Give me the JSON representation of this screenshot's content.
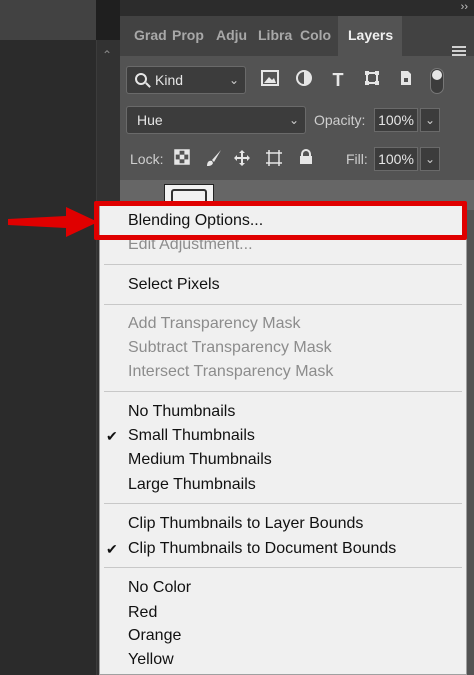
{
  "tabs": [
    "Grad",
    "Prop",
    "Adju",
    "Libra",
    "Colo",
    "Layers"
  ],
  "active_tab": "Layers",
  "filter": {
    "kind_label": "Kind"
  },
  "blend": {
    "mode": "Hue",
    "opacity_label": "Opacity:",
    "opacity_value": "100%"
  },
  "lock": {
    "label": "Lock:",
    "fill_label": "Fill:",
    "fill_value": "100%"
  },
  "menu": {
    "items": [
      {
        "label": "Blending Options...",
        "enabled": true,
        "checked": false
      },
      {
        "label": "Edit Adjustment...",
        "enabled": false,
        "checked": false
      },
      {
        "label": "Select Pixels",
        "enabled": true,
        "checked": false
      },
      {
        "label": "Add Transparency Mask",
        "enabled": false,
        "checked": false
      },
      {
        "label": "Subtract Transparency Mask",
        "enabled": false,
        "checked": false
      },
      {
        "label": "Intersect Transparency Mask",
        "enabled": false,
        "checked": false
      },
      {
        "label": "No Thumbnails",
        "enabled": true,
        "checked": false
      },
      {
        "label": "Small Thumbnails",
        "enabled": true,
        "checked": true
      },
      {
        "label": "Medium Thumbnails",
        "enabled": true,
        "checked": false
      },
      {
        "label": "Large Thumbnails",
        "enabled": true,
        "checked": false
      },
      {
        "label": "Clip Thumbnails to Layer Bounds",
        "enabled": true,
        "checked": false
      },
      {
        "label": "Clip Thumbnails to Document Bounds",
        "enabled": true,
        "checked": true
      },
      {
        "label": "No Color",
        "enabled": true,
        "checked": false
      },
      {
        "label": "Red",
        "enabled": true,
        "checked": false
      },
      {
        "label": "Orange",
        "enabled": true,
        "checked": false
      },
      {
        "label": "Yellow",
        "enabled": true,
        "checked": false
      }
    ],
    "check_glyph": "✔"
  },
  "icons": {
    "collapse": "››",
    "filter": [
      "image-filter-icon",
      "adjustment-filter-icon",
      "type-filter-icon",
      "shape-filter-icon",
      "smart-object-filter-icon"
    ],
    "lock": [
      "lock-transparent-icon",
      "lock-image-icon",
      "lock-position-icon",
      "lock-artboard-icon",
      "lock-all-icon"
    ]
  },
  "colors": {
    "highlight": "#e00000",
    "panel_bg": "#535353",
    "menu_bg": "#f0f0f0"
  }
}
